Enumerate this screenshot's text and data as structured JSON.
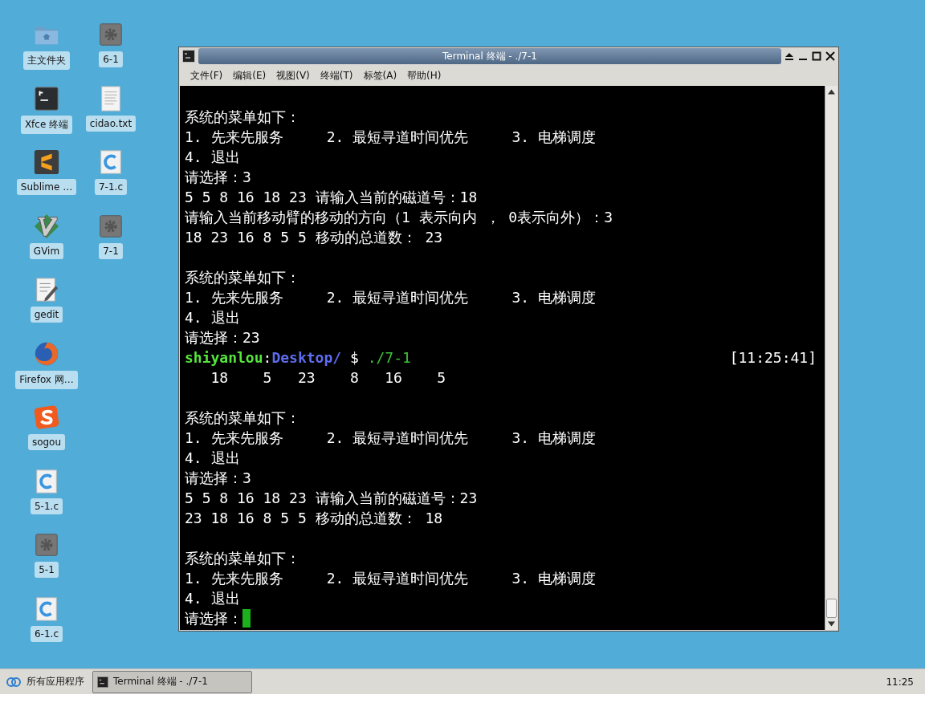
{
  "desktop_icons": [
    {
      "label": "主文件夹",
      "kind": "folder"
    },
    {
      "label": "Xfce 终端",
      "kind": "terminal"
    },
    {
      "label": "Sublime …",
      "kind": "sublime"
    },
    {
      "label": "GVim",
      "kind": "vim"
    },
    {
      "label": "gedit",
      "kind": "editor"
    },
    {
      "label": "Firefox 网…",
      "kind": "browser"
    },
    {
      "label": "sogou",
      "kind": "sogou"
    },
    {
      "label": "5-1.c",
      "kind": "c-source"
    },
    {
      "label": "5-1",
      "kind": "executable"
    },
    {
      "label": "6-1.c",
      "kind": "c-source"
    },
    {
      "label": "6-1",
      "kind": "executable"
    },
    {
      "label": "cidao.txt",
      "kind": "text"
    },
    {
      "label": "7-1.c",
      "kind": "c-source"
    },
    {
      "label": "7-1",
      "kind": "executable"
    }
  ],
  "window": {
    "title": "Terminal 终端 - ./7-1",
    "menu": [
      "文件(F)",
      "编辑(E)",
      "视图(V)",
      "终端(T)",
      "标签(A)",
      "帮助(H)"
    ],
    "lines": [
      {
        "kind": "blank"
      },
      {
        "kind": "text",
        "text": "系统的菜单如下："
      },
      {
        "kind": "text",
        "text": "1. 先来先服务     2. 最短寻道时间优先     3. 电梯调度"
      },
      {
        "kind": "text",
        "text": "4. 退出"
      },
      {
        "kind": "text",
        "text": "请选择：3"
      },
      {
        "kind": "text",
        "text": "5 5 8 16 18 23 请输入当前的磁道号：18"
      },
      {
        "kind": "text",
        "text": "请输入当前移动臂的移动的方向（1 表示向内 ， 0表示向外）：3"
      },
      {
        "kind": "text",
        "text": "18 23 16 8 5 5 移动的总道数： 23"
      },
      {
        "kind": "blank"
      },
      {
        "kind": "text",
        "text": "系统的菜单如下："
      },
      {
        "kind": "text",
        "text": "1. 先来先服务     2. 最短寻道时间优先     3. 电梯调度"
      },
      {
        "kind": "text",
        "text": "4. 退出"
      },
      {
        "kind": "text",
        "text": "请选择：23"
      },
      {
        "kind": "prompt",
        "user": "shiyanlou",
        "separator": ":",
        "path": "Desktop/",
        "symbol": "$",
        "command": "./7-1",
        "time": "[11:25:41]"
      },
      {
        "kind": "text",
        "text": "   18    5   23    8   16    5"
      },
      {
        "kind": "blank"
      },
      {
        "kind": "text",
        "text": "系统的菜单如下："
      },
      {
        "kind": "text",
        "text": "1. 先来先服务     2. 最短寻道时间优先     3. 电梯调度"
      },
      {
        "kind": "text",
        "text": "4. 退出"
      },
      {
        "kind": "text",
        "text": "请选择：3"
      },
      {
        "kind": "text",
        "text": "5 5 8 16 18 23 请输入当前的磁道号：23"
      },
      {
        "kind": "text",
        "text": "23 18 16 8 5 5 移动的总道数： 18"
      },
      {
        "kind": "blank"
      },
      {
        "kind": "text",
        "text": "系统的菜单如下："
      },
      {
        "kind": "text",
        "text": "1. 先来先服务     2. 最短寻道时间优先     3. 电梯调度"
      },
      {
        "kind": "text",
        "text": "4. 退出"
      },
      {
        "kind": "text",
        "text": "请选择：",
        "cursor": true
      }
    ]
  },
  "taskbar": {
    "start_label": "所有应用程序",
    "tasks": [
      {
        "label": "Terminal 终端 - ./7-1",
        "selected": true
      }
    ],
    "clock": "11:25"
  }
}
